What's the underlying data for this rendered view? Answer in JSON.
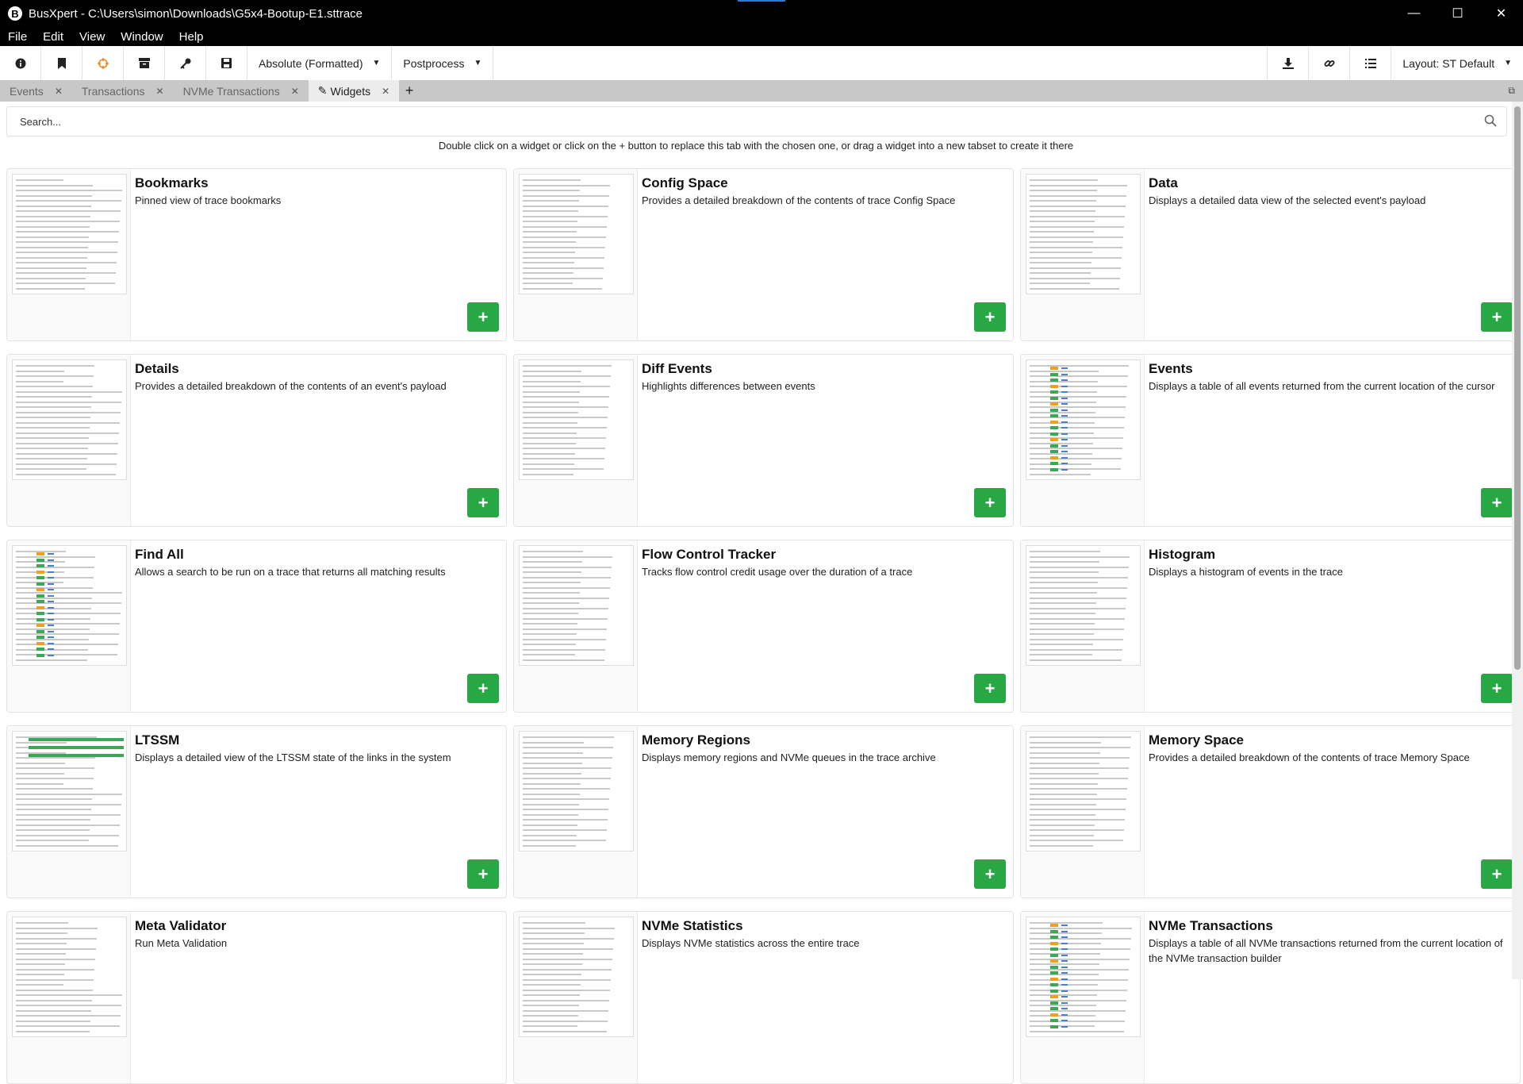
{
  "window": {
    "title": "BusXpert - C:\\Users\\simon\\Downloads\\G5x4-Bootup-E1.sttrace",
    "app_icon_letter": "B"
  },
  "menu": [
    "File",
    "Edit",
    "View",
    "Window",
    "Help"
  ],
  "toolbar": {
    "timestamp_format": "Absolute (Formatted)",
    "postprocess": "Postprocess",
    "layout": "Layout: ST Default",
    "accent_color": "#e88a1a"
  },
  "tabs": [
    {
      "label": "Events",
      "active": false
    },
    {
      "label": "Transactions",
      "active": false
    },
    {
      "label": "NVMe Transactions",
      "active": false
    },
    {
      "label": "Widgets",
      "active": true
    }
  ],
  "search": {
    "placeholder": "Search..."
  },
  "hint": "Double click on a widget or click on the + button to replace this tab with the chosen one, or drag a widget into a new tabset to create it there",
  "widgets": [
    {
      "title": "Bookmarks",
      "description": "Pinned view of trace bookmarks"
    },
    {
      "title": "Config Space",
      "description": "Provides a detailed breakdown of the contents of trace Config Space"
    },
    {
      "title": "Data",
      "description": "Displays a detailed data view of the selected event's payload"
    },
    {
      "title": "Details",
      "description": "Provides a detailed breakdown of the contents of an event's payload"
    },
    {
      "title": "Diff Events",
      "description": "Highlights differences between events"
    },
    {
      "title": "Events",
      "description": "Displays a table of all events returned from the current location of the cursor"
    },
    {
      "title": "Find All",
      "description": "Allows a search to be run on a trace that returns all matching results"
    },
    {
      "title": "Flow Control Tracker",
      "description": "Tracks flow control credit usage over the duration of a trace"
    },
    {
      "title": "Histogram",
      "description": "Displays a histogram of events in the trace"
    },
    {
      "title": "LTSSM",
      "description": "Displays a detailed view of the LTSSM state of the links in the system"
    },
    {
      "title": "Memory Regions",
      "description": "Displays memory regions and NVMe queues in the trace archive"
    },
    {
      "title": "Memory Space",
      "description": "Provides a detailed breakdown of the contents of trace Memory Space"
    },
    {
      "title": "Meta Validator",
      "description": "Run Meta Validation"
    },
    {
      "title": "NVMe Statistics",
      "description": "Displays NVMe statistics across the entire trace"
    },
    {
      "title": "NVMe Transactions",
      "description": "Displays a table of all NVMe transactions returned from the current location of the NVMe transaction builder"
    }
  ],
  "add_button_label": "+",
  "add_button_color": "#28a745"
}
